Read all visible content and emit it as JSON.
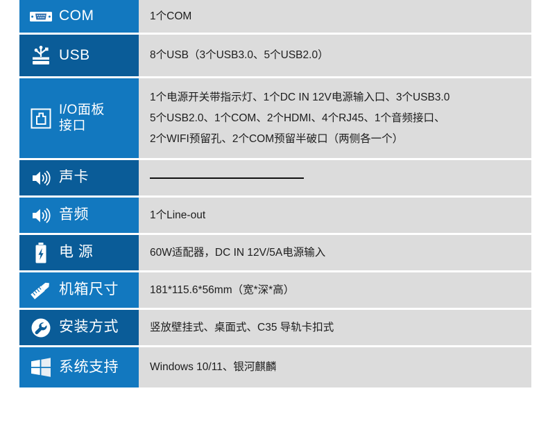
{
  "theme": {
    "blue_dark": "#0a5c98",
    "blue_light": "#1278bf",
    "value_bg": "#dcdcdc",
    "page_bg": "#ffffff",
    "text_color": "#1d1d1d",
    "label_text_color": "#ffffff"
  },
  "spec_table": {
    "rows": [
      {
        "icon": "serial-db9-port-icon",
        "label": "COM",
        "shade": "light",
        "value_lines": [
          "1个COM"
        ]
      },
      {
        "icon": "usb-icon",
        "label": "USB",
        "shade": "dark",
        "value_lines": [
          "8个USB（3个USB3.0、5个USB2.0）"
        ]
      },
      {
        "icon": "io-panel-port-icon",
        "label": "I/O面板\n接口",
        "shade": "light",
        "value_lines": [
          "1个电源开关带指示灯、1个DC IN 12V电源输入口、3个USB3.0",
          "5个USB2.0、1个COM、2个HDMI、4个RJ45、1个音频接口、",
          "2个WIFI预留孔、2个COM预留半破口（两侧各一个）"
        ]
      },
      {
        "icon": "speaker-icon",
        "label": "声卡",
        "shade": "dark",
        "value_lines": [],
        "value_rule": true
      },
      {
        "icon": "speaker-icon",
        "label": "音频",
        "shade": "light",
        "value_lines": [
          "1个Line-out"
        ]
      },
      {
        "icon": "battery-icon",
        "label": "电 源",
        "shade": "dark",
        "value_lines": [
          "60W适配器，DC IN 12V/5A电源输入"
        ]
      },
      {
        "icon": "ruler-pencil-icon",
        "label": "机箱尺寸",
        "shade": "light",
        "value_lines": [
          "181*115.6*56mm（宽*深*高）"
        ]
      },
      {
        "icon": "wrench-circle-icon",
        "label": "安装方式",
        "shade": "dark",
        "value_lines": [
          "竖放壁挂式、桌面式、C35 导轨卡扣式"
        ]
      },
      {
        "icon": "windows-logo-icon",
        "label": "系统支持",
        "shade": "light",
        "value_lines": [
          "Windows 10/11、银河麒麟"
        ]
      }
    ]
  }
}
